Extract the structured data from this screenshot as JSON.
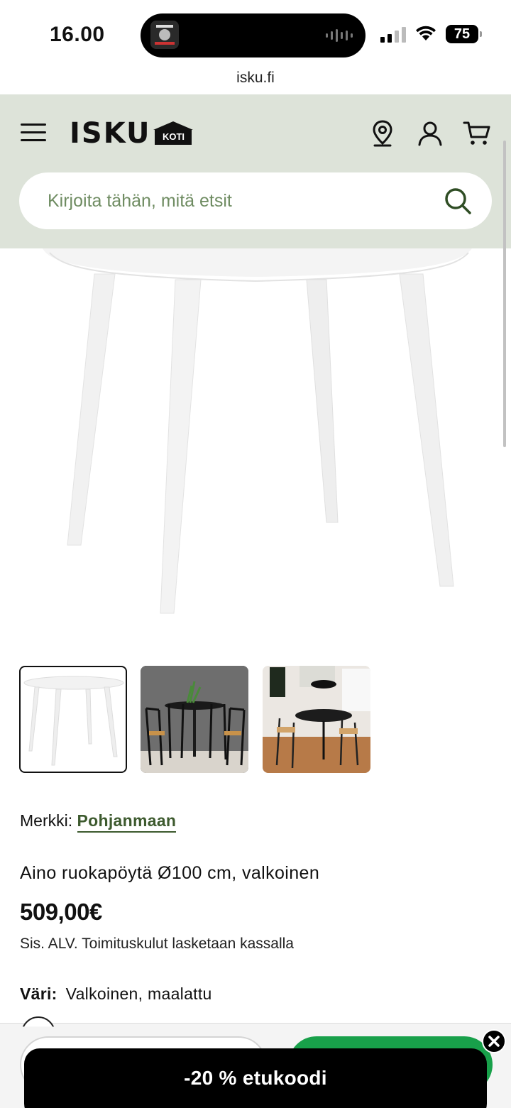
{
  "status_bar": {
    "time": "16.00",
    "battery": "75",
    "url": "isku.fi"
  },
  "header": {
    "logo_text": "ISKU",
    "logo_badge": "KOTI",
    "search_placeholder": "Kirjoita tähän, mitä etsit"
  },
  "product": {
    "brand_label": "Merkki:",
    "brand_name": "Pohjanmaan",
    "title": "Aino ruokapöytä Ø100 cm, valkoinen",
    "price": "509,00€",
    "tax_note": "Sis. ALV. Toimituskulut lasketaan kassalla",
    "color_label": "Väri:",
    "color_value": "Valkoinen, maalattu",
    "thumbnails": [
      "table-white",
      "dining-set-black-chairs",
      "dining-room-round-table"
    ]
  },
  "promo": {
    "text": "-20 % etukoodi"
  },
  "colors": {
    "header_bg": "#dde3d9",
    "brand_green": "#3d5a2e",
    "cta_green": "#18a04a",
    "search_placeholder": "#6f8c62"
  }
}
